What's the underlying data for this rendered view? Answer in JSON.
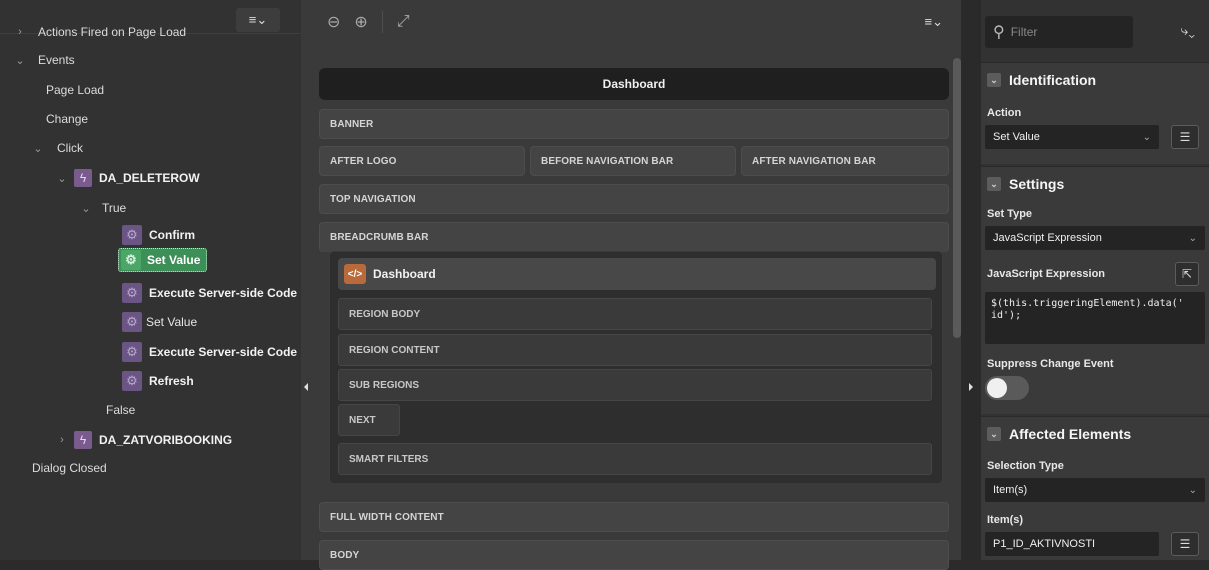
{
  "left": {
    "menu_icon": "list-menu-icon",
    "tree": [
      {
        "label": "Actions Fired on Page Load",
        "type": "header"
      },
      {
        "label": "Events"
      },
      {
        "label": "Page Load"
      },
      {
        "label": "Change"
      },
      {
        "label": "Click"
      },
      {
        "label": "DA_DELETEROW"
      },
      {
        "label": "True"
      },
      {
        "label": "Confirm"
      },
      {
        "label": "Set Value",
        "selected": true
      },
      {
        "label": "Execute Server-side Code"
      },
      {
        "label": "Set Value"
      },
      {
        "label": "Execute Server-side Code"
      },
      {
        "label": "Refresh"
      },
      {
        "label": "False"
      },
      {
        "label": "DA_ZATVORIBOOKING"
      },
      {
        "label": "Dialog Closed"
      }
    ]
  },
  "center": {
    "toolbar": {
      "zoom_out": "zoom-out-icon",
      "zoom_in": "zoom-in-icon",
      "expand": "expand-icon"
    },
    "page_title": "Dashboard",
    "regions": {
      "banner": "BANNER",
      "after_logo": "AFTER LOGO",
      "before_nav": "BEFORE NAVIGATION BAR",
      "after_nav": "AFTER NAVIGATION BAR",
      "top_nav": "TOP NAVIGATION",
      "breadcrumb": "BREADCRUMB BAR",
      "full_width": "FULL WIDTH CONTENT",
      "body": "BODY"
    },
    "inner": {
      "code_label": "</>",
      "title": "Dashboard",
      "region_body": "REGION BODY",
      "region_content": "REGION CONTENT",
      "sub_regions": "SUB REGIONS",
      "next": "NEXT",
      "smart_filters": "SMART FILTERS"
    }
  },
  "right": {
    "filter_placeholder": "Filter",
    "identification": {
      "title": "Identification",
      "action_label": "Action",
      "action_value": "Set Value"
    },
    "settings": {
      "title": "Settings",
      "set_type_label": "Set Type",
      "set_type_value": "JavaScript Expression",
      "js_label": "JavaScript Expression",
      "js_value": "$(this.triggeringElement).data('\nid');",
      "suppress_label": "Suppress Change Event",
      "suppress_on": false
    },
    "affected": {
      "title": "Affected Elements",
      "selection_type_label": "Selection Type",
      "selection_type_value": "Item(s)",
      "items_label": "Item(s)",
      "items_value": "P1_ID_AKTIVNOSTI"
    }
  },
  "colors": {
    "selected": "#3c8f57",
    "da_icon": "#7a5b8e",
    "code_icon": "#b86a3a"
  }
}
